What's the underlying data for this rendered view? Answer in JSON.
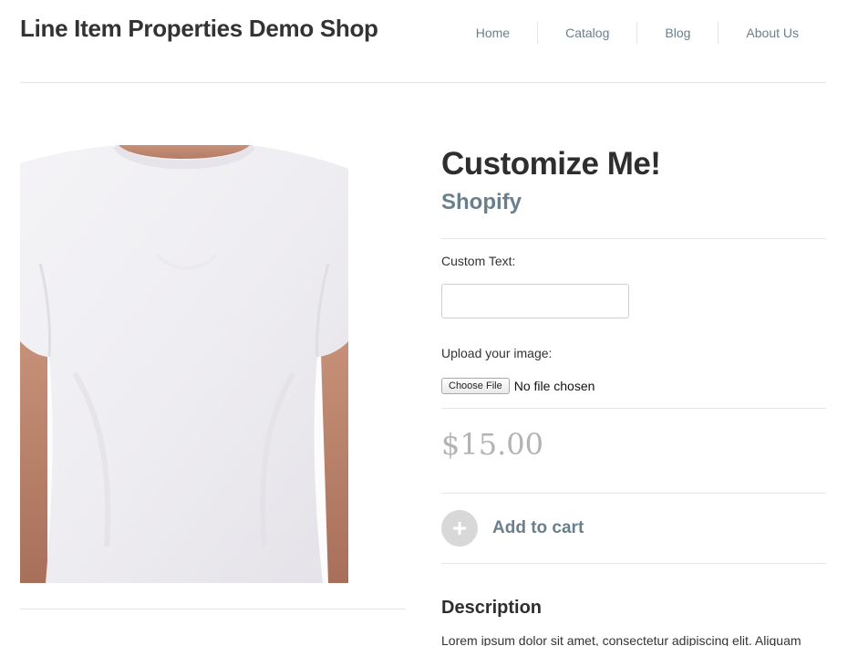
{
  "header": {
    "site_title": "Line Item Properties Demo Shop",
    "nav": [
      {
        "label": "Home"
      },
      {
        "label": "Catalog"
      },
      {
        "label": "Blog"
      },
      {
        "label": "About Us"
      }
    ]
  },
  "product": {
    "image_icon": "t-shirt-photo",
    "title": "Customize Me!",
    "vendor": "Shopify",
    "custom_text": {
      "label": "Custom Text:",
      "value": "",
      "placeholder": ""
    },
    "upload": {
      "label": "Upload your image:",
      "button_label": "Choose File",
      "status": "No file chosen"
    },
    "price": "$15.00",
    "add_to_cart": {
      "label": "Add to cart",
      "icon": "plus-icon"
    },
    "description": {
      "heading": "Description",
      "text": "Lorem ipsum dolor sit amet, consectetur adipiscing elit. Aliquam"
    }
  },
  "colors": {
    "accent": "#6a7f8c",
    "title": "#2e2e2e",
    "price": "#b3b3b3",
    "rule": "#e6e6e6",
    "button_circle": "#d8d8d8"
  }
}
